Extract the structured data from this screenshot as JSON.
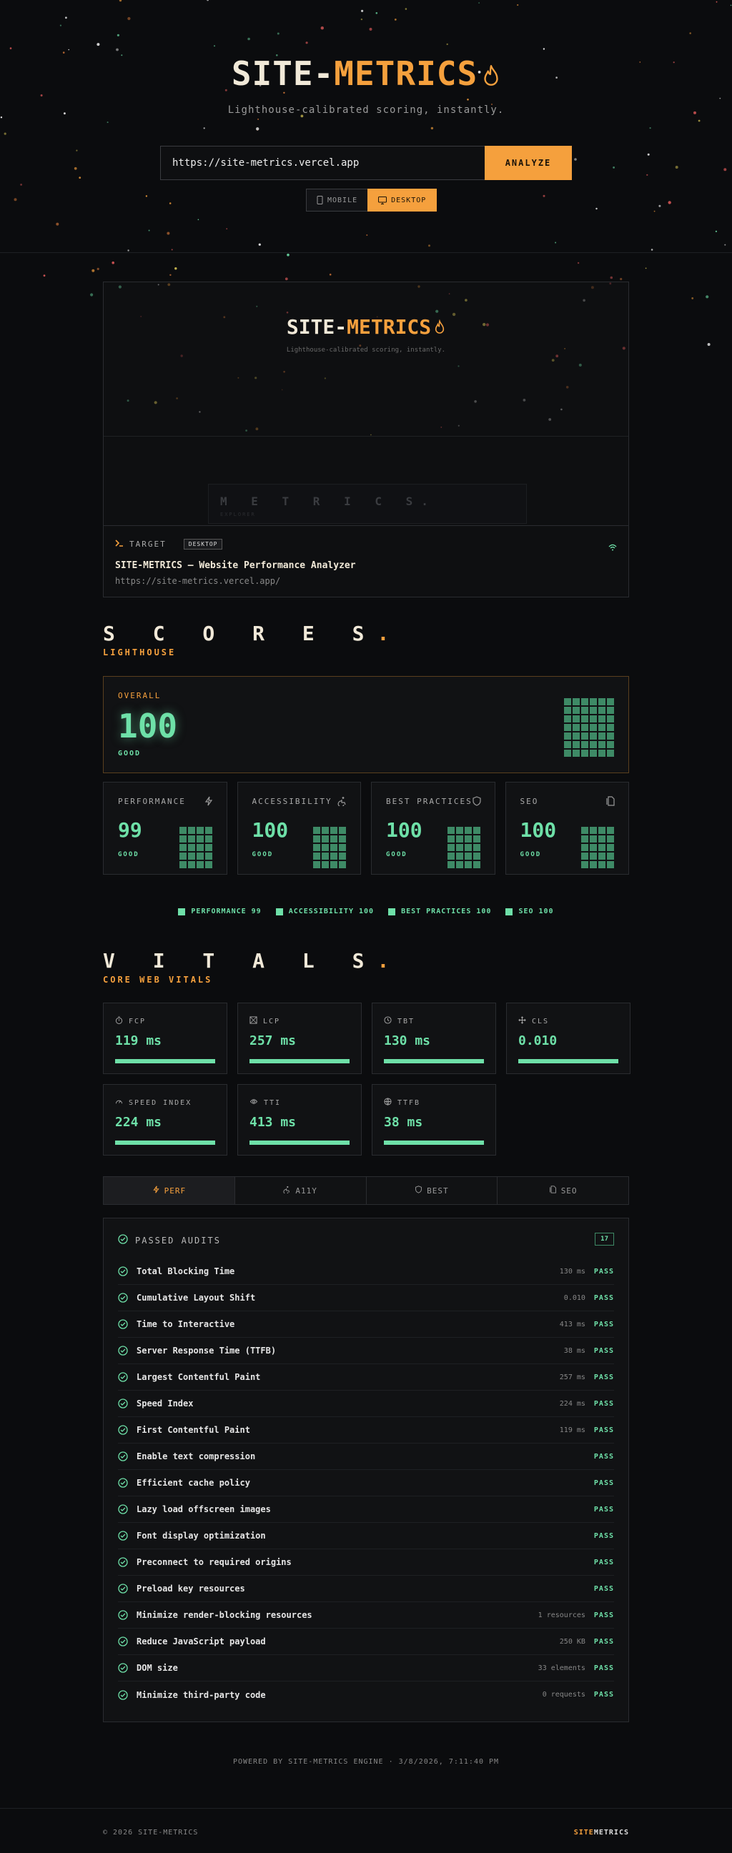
{
  "brand": {
    "part1": "SITE-",
    "part2": "METRICS",
    "tagline": "Lighthouse-calibrated scoring, instantly."
  },
  "search": {
    "value": "https://site-metrics.vercel.app",
    "analyze_label": "ANALYZE"
  },
  "device": {
    "mobile_label": "MOBILE",
    "desktop_label": "DESKTOP"
  },
  "preview": {
    "metrics_text": "M E T R I C S.",
    "sub_text": "EXPLORER",
    "target_label": "TARGET",
    "device_badge": "DESKTOP",
    "site_title": "SITE-METRICS — Website Performance Analyzer",
    "site_url": "https://site-metrics.vercel.app/"
  },
  "scores": {
    "title": "S C O R E S",
    "dot": ".",
    "subtitle": "LIGHTHOUSE",
    "overall": {
      "label": "OVERALL",
      "score": "100",
      "status": "GOOD"
    },
    "cards": [
      {
        "label": "PERFORMANCE",
        "score": "99",
        "status": "GOOD",
        "icon": "bolt-icon"
      },
      {
        "label": "ACCESSIBILITY",
        "score": "100",
        "status": "GOOD",
        "icon": "accessibility-icon"
      },
      {
        "label": "BEST PRACTICES",
        "score": "100",
        "status": "GOOD",
        "icon": "shield-icon"
      },
      {
        "label": "SEO",
        "score": "100",
        "status": "GOOD",
        "icon": "document-icon"
      }
    ],
    "legend": [
      "PERFORMANCE 99",
      "ACCESSIBILITY 100",
      "BEST PRACTICES 100",
      "SEO 100"
    ]
  },
  "vitals": {
    "title": "V I T A L S",
    "dot": ".",
    "subtitle": "CORE WEB VITALS",
    "items": [
      {
        "label": "FCP",
        "value": "119 ms",
        "fill": 1.0,
        "icon": "timer-icon"
      },
      {
        "label": "LCP",
        "value": "257 ms",
        "fill": 1.0,
        "icon": "image-box-icon"
      },
      {
        "label": "TBT",
        "value": "130 ms",
        "fill": 1.0,
        "icon": "clock-icon"
      },
      {
        "label": "CLS",
        "value": "0.010",
        "fill": 1.0,
        "icon": "move-icon"
      },
      {
        "label": "SPEED INDEX",
        "value": "224 ms",
        "fill": 1.0,
        "icon": "gauge-icon"
      },
      {
        "label": "TTI",
        "value": "413 ms",
        "fill": 1.0,
        "icon": "eye-icon"
      },
      {
        "label": "TTFB",
        "value": "38 ms",
        "fill": 1.0,
        "icon": "globe-icon"
      }
    ]
  },
  "tabs": [
    {
      "label": "PERF",
      "icon": "bolt-icon",
      "active": true
    },
    {
      "label": "A11Y",
      "icon": "accessibility-icon",
      "active": false
    },
    {
      "label": "BEST",
      "icon": "shield-icon",
      "active": false
    },
    {
      "label": "SEO",
      "icon": "document-icon",
      "active": false
    }
  ],
  "audits": {
    "heading": "PASSED AUDITS",
    "count": "17",
    "pass_label": "PASS",
    "rows": [
      {
        "name": "Total Blocking Time",
        "value": "130 ms"
      },
      {
        "name": "Cumulative Layout Shift",
        "value": "0.010"
      },
      {
        "name": "Time to Interactive",
        "value": "413 ms"
      },
      {
        "name": "Server Response Time (TTFB)",
        "value": "38 ms"
      },
      {
        "name": "Largest Contentful Paint",
        "value": "257 ms"
      },
      {
        "name": "Speed Index",
        "value": "224 ms"
      },
      {
        "name": "First Contentful Paint",
        "value": "119 ms"
      },
      {
        "name": "Enable text compression",
        "value": ""
      },
      {
        "name": "Efficient cache policy",
        "value": ""
      },
      {
        "name": "Lazy load offscreen images",
        "value": ""
      },
      {
        "name": "Font display optimization",
        "value": ""
      },
      {
        "name": "Preconnect to required origins",
        "value": ""
      },
      {
        "name": "Preload key resources",
        "value": ""
      },
      {
        "name": "Minimize render-blocking resources",
        "value": "1 resources"
      },
      {
        "name": "Reduce JavaScript payload",
        "value": "250 KB"
      },
      {
        "name": "DOM size",
        "value": "33 elements"
      },
      {
        "name": "Minimize third-party code",
        "value": "0 requests"
      }
    ]
  },
  "powered": "POWERED BY SITE-METRICS ENGINE · 3/8/2026, 7:11:40 PM",
  "footer": {
    "copyright": "© 2026 SITE-METRICS",
    "brand1": "SITE",
    "brand2": "METRICS"
  },
  "colors": {
    "accent": "#f5a03d",
    "good": "#6ee0a8",
    "background": "#0b0c0e"
  }
}
